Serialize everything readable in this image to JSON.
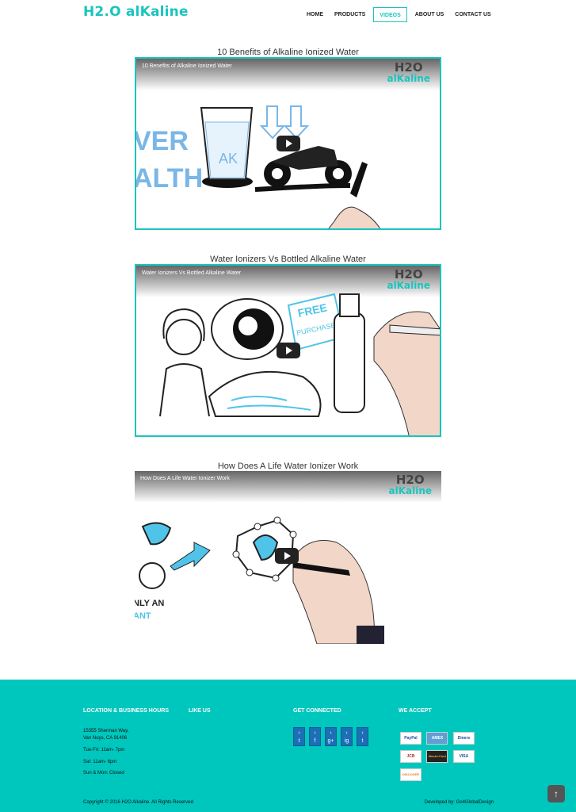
{
  "header": {
    "logo": "H2.O alKaline",
    "nav": [
      {
        "label": "HOME"
      },
      {
        "label": "PRODUCTS"
      },
      {
        "label": "VIDEOS",
        "active": true
      },
      {
        "label": "ABOUT US"
      },
      {
        "label": "CONTACT US"
      }
    ]
  },
  "videos": [
    {
      "title": "10 Benefits of Alkaline Ionized Water",
      "player_title": "10 Benefits of Alkaline Ionized Water",
      "brand_top": "H2O",
      "brand_bottom": "alKaline"
    },
    {
      "title": "Water Ionizers Vs Bottled Alkaline Water",
      "player_title": "Water Ionizers Vs Bottled Alkaline Water",
      "brand_top": "H2O",
      "brand_bottom": "alKaline"
    },
    {
      "title": "How Does A Life Water Ionizer Work",
      "player_title": "How Does A Life Water Ionizer Work",
      "brand_top": "H2O",
      "brand_bottom": "alKaline"
    }
  ],
  "art_text": {
    "v1_left_top": "VER",
    "v1_left_bottom": "ALTH",
    "v1_glass": "AK",
    "v2_sign_top": "FREE",
    "v2_sign_bottom": "PURCHASE",
    "v3_left_top": "NLY AN",
    "v3_left_bottom": "ANT"
  },
  "footer": {
    "location_heading": "LOCATION & BUSINESS HOURS",
    "like_heading": "LIKE US",
    "connected_heading": "GET CONNECTED",
    "accept_heading": "WE ACCEPT",
    "address_line1": "15355 Sherman Way,",
    "address_line2": "Van Nuys, CA 91406",
    "hours_tue_fri": "Tue-Fri: 11am- 7pm",
    "hours_sat": "Sat: 11am- 6pm",
    "hours_closed": "Sun & Mon: Closed",
    "social": [
      "twitter",
      "facebook",
      "google-plus",
      "instagram",
      "tumblr"
    ],
    "social_glyphs": [
      "t",
      "f",
      "g+",
      "ig",
      "t"
    ],
    "cards": [
      "PayPal",
      "AMEX",
      "Diners",
      "JCB",
      "MasterCard",
      "VISA",
      "DISCOVER"
    ],
    "copyright": "Copyright © 2016 H2O Alkaline. All Rights Reserved",
    "developed": "Developed by: Go4GlobalDesign",
    "to_top_icon": "arrow-up-circle-icon"
  },
  "colors": {
    "accent": "#1bc4be",
    "footer_bg": "#00c7bd",
    "social_bg": "#1a6fb5"
  }
}
